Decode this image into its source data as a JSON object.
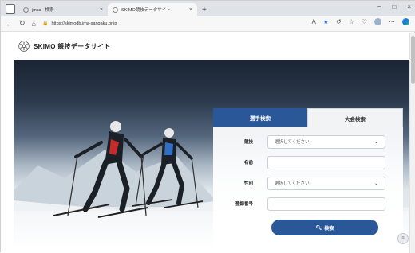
{
  "browser": {
    "tabs": [
      {
        "title": "jmsa - 検索",
        "active": false
      },
      {
        "title": "SKIMO競技データサイト",
        "active": true
      }
    ],
    "new_tab": "+",
    "window_controls": [
      "−",
      "□",
      "×"
    ],
    "url": "https://skimodb.jma-sangaku.or.jp",
    "icons": {
      "back": "arrow-left-icon",
      "forward": "arrow-right-icon",
      "home": "home-icon",
      "reload": "reload-icon",
      "favorite": "star-icon"
    }
  },
  "site": {
    "name": "SKIMO 競技データサイト"
  },
  "search": {
    "tabs": [
      {
        "label": "選手検索",
        "selected": true
      },
      {
        "label": "大会検索",
        "selected": false
      }
    ],
    "fields": {
      "competition": {
        "label": "競技",
        "value": "選択してください"
      },
      "name": {
        "label": "名前",
        "value": ""
      },
      "gender": {
        "label": "性別",
        "value": "選択してください"
      },
      "reg_no": {
        "label": "登録番号",
        "value": ""
      }
    },
    "button": "検索"
  },
  "colors": {
    "accent": "#2a5797",
    "tab_inactive_bg": "#f1f3f5"
  }
}
